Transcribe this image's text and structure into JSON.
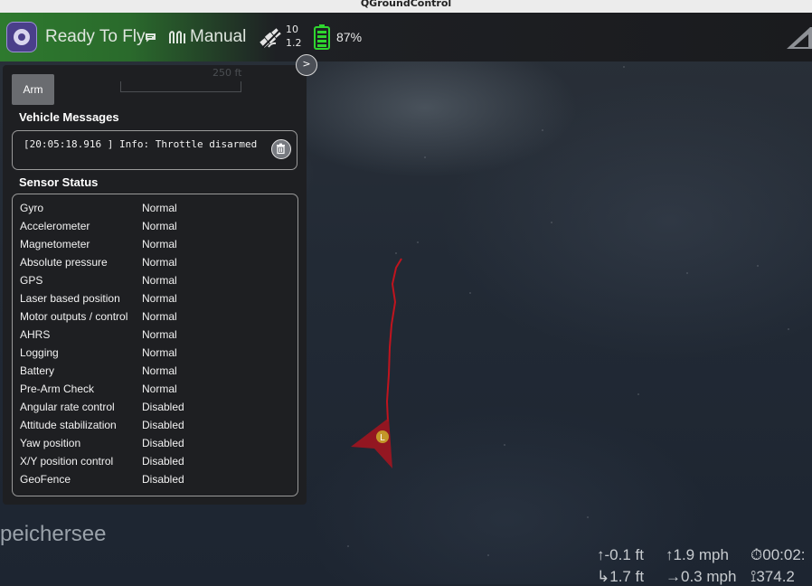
{
  "window": {
    "title": "QGroundControl"
  },
  "toolbar": {
    "status": "Ready To Fly",
    "flight_mode": "Manual",
    "gps_satellites": "10",
    "gps_hdop": "1.2",
    "battery_percent": "87%",
    "colors": {
      "ready_green": "#2e7a2e",
      "battery_green": "#2fd62f"
    }
  },
  "panel": {
    "toggle_label": ">",
    "arm_label": "Arm",
    "scale_label": "250 ft",
    "vehicle_messages_title": "Vehicle Messages",
    "messages": [
      "[20:05:18.916 ] Info: Throttle disarmed"
    ],
    "sensor_status_title": "Sensor Status",
    "sensors": [
      {
        "name": "Gyro",
        "status": "Normal"
      },
      {
        "name": "Accelerometer",
        "status": "Normal"
      },
      {
        "name": "Magnetometer",
        "status": "Normal"
      },
      {
        "name": "Absolute pressure",
        "status": "Normal"
      },
      {
        "name": "GPS",
        "status": "Normal"
      },
      {
        "name": "Laser based position",
        "status": "Normal"
      },
      {
        "name": "Motor outputs / control",
        "status": "Normal"
      },
      {
        "name": "AHRS",
        "status": "Normal"
      },
      {
        "name": "Logging",
        "status": "Normal"
      },
      {
        "name": "Battery",
        "status": "Normal"
      },
      {
        "name": "Pre-Arm Check",
        "status": "Normal"
      },
      {
        "name": "Angular rate control",
        "status": "Disabled"
      },
      {
        "name": "Attitude stabilization",
        "status": "Disabled"
      },
      {
        "name": "Yaw position",
        "status": "Disabled"
      },
      {
        "name": "X/Y position control",
        "status": "Disabled"
      },
      {
        "name": "GeoFence",
        "status": "Disabled"
      }
    ]
  },
  "map": {
    "label": "peichersee",
    "vehicle_marker": "L",
    "track_color": "#c0141e"
  },
  "telemetry": {
    "altitude": "-0.1 ft",
    "vertical_speed": "1.9 mph",
    "flight_time": "00:02:",
    "distance": "1.7 ft",
    "ground_speed": "0.3 mph",
    "total_distance": "374.2"
  }
}
